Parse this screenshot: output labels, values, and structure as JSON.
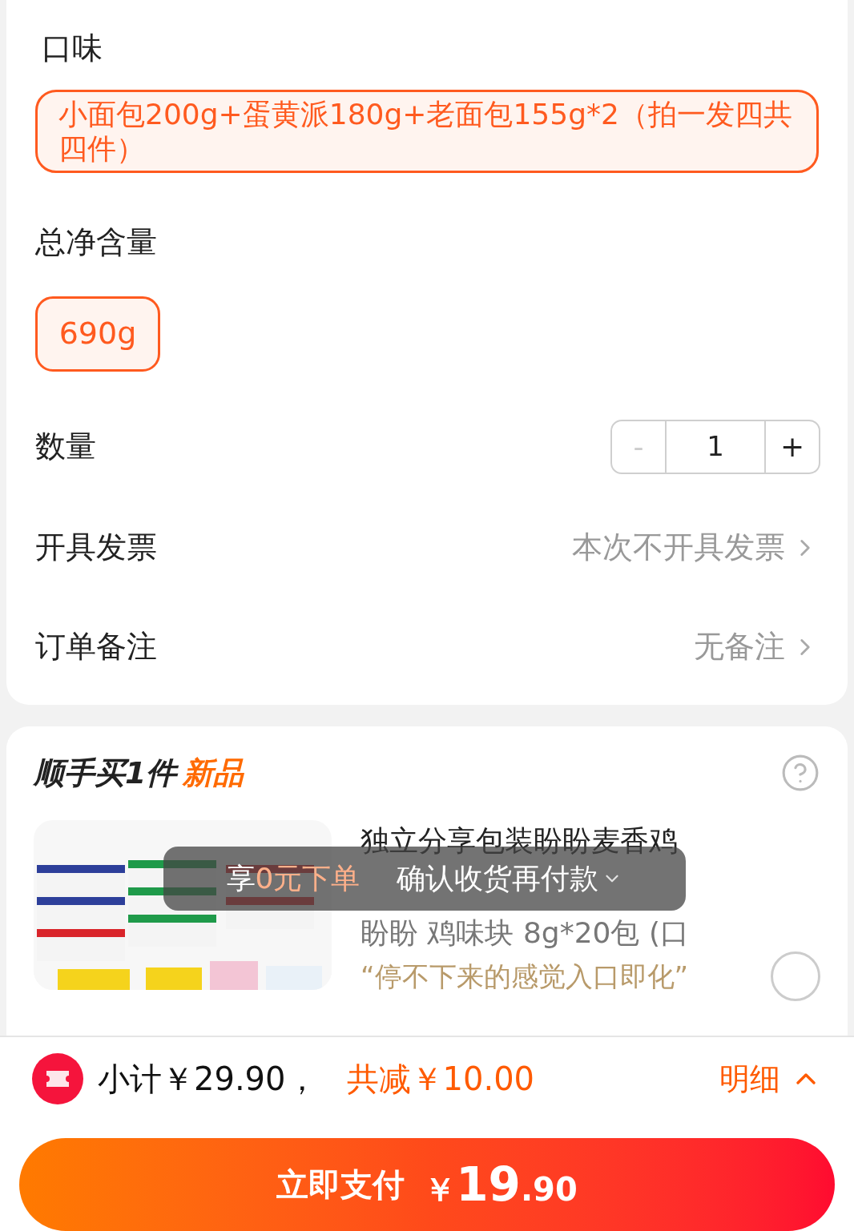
{
  "flavor": {
    "label": "口味",
    "options": [
      {
        "label": "小面包200g+蛋黄派180g+老面包155g*2（拍一发四共四件）",
        "selected": true
      }
    ]
  },
  "net_weight": {
    "label": "总净含量",
    "options": [
      {
        "label": "690g",
        "selected": true
      }
    ]
  },
  "quantity": {
    "label": "数量",
    "minus": "-",
    "value": "1",
    "plus": "+",
    "minus_disabled": true
  },
  "invoice": {
    "label": "开具发票",
    "value": "本次不开具发票"
  },
  "note": {
    "label": "订单备注",
    "value": "无备注"
  },
  "addon": {
    "title": "顺手买1件",
    "badge": "新品",
    "product": {
      "kind": "picture",
      "title": "独立分享包装盼盼麦香鸡",
      "subtitle": "盼盼 鸡味块 8g*20包 (口",
      "quote": "“停不下来的感觉入口即化”",
      "selected": false
    }
  },
  "toast": {
    "prefix": "享",
    "highlight": "0元",
    "suffix": "下单",
    "text": "确认收货再付款"
  },
  "summary": {
    "subtotal": "小计￥29.90，",
    "discount": "共减￥10.00",
    "details": "明细"
  },
  "pay_button": {
    "label": "立即支付",
    "currency": "￥",
    "integer": "19",
    "decimal": ".90"
  }
}
